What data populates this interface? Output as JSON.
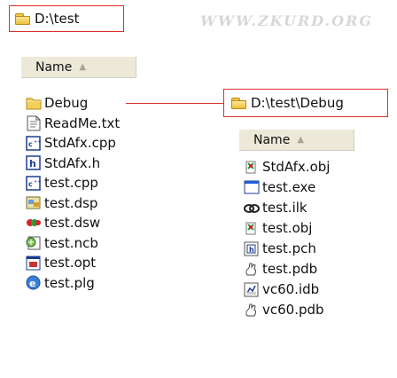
{
  "left_path": "D:\\test",
  "watermark": "WWW.ZKURD.ORG",
  "left_header": "Name",
  "left_items": [
    "Debug",
    "ReadMe.txt",
    "StdAfx.cpp",
    "StdAfx.h",
    "test.cpp",
    "test.dsp",
    "test.dsw",
    "test.ncb",
    "test.opt",
    "test.plg"
  ],
  "right_path": "D:\\test\\Debug",
  "right_header": "Name",
  "right_items": [
    "StdAfx.obj",
    "test.exe",
    "test.ilk",
    "test.obj",
    "test.pch",
    "test.pdb",
    "vc60.idb",
    "vc60.pdb"
  ],
  "colors": {
    "highlight": "#d9322b",
    "header_bg": "#ece9d8",
    "watermark": "#d7d7d7"
  }
}
